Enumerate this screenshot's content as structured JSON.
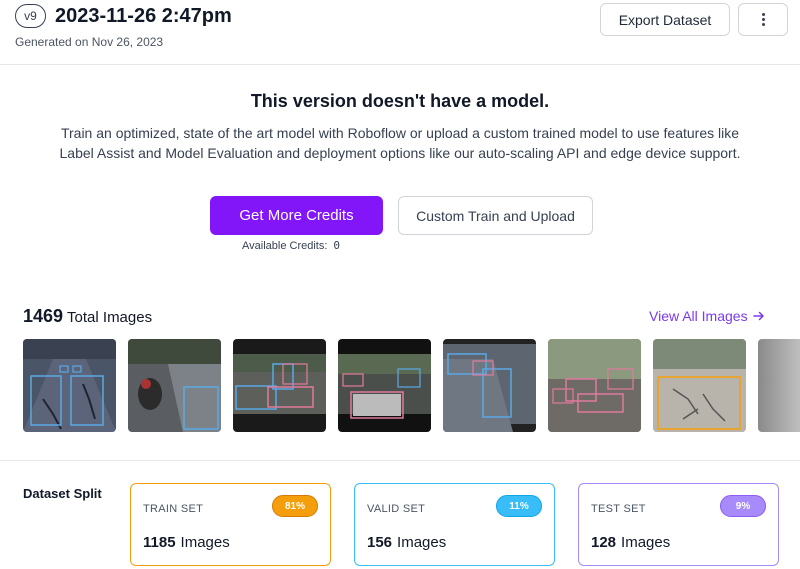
{
  "header": {
    "version": "v9",
    "title": "2023-11-26 2:47pm",
    "subtitle": "Generated on Nov 26, 2023",
    "export_label": "Export Dataset",
    "more_icon": "kebab-menu-icon"
  },
  "no_model": {
    "heading": "This version doesn't have a model.",
    "description": "Train an optimized, state of the art model with Roboflow or upload a custom trained model to use features like Label Assist and Model Evaluation and deployment options like our auto-scaling API and edge device support.",
    "primary_button": "Get More Credits",
    "secondary_button": "Custom Train and Upload",
    "credits_label": "Available Credits:",
    "credits_value": "0"
  },
  "images": {
    "count": "1469",
    "label": "Total Images",
    "view_all": "View All Images",
    "view_all_icon": "arrow-right-icon"
  },
  "split": {
    "label": "Dataset Split",
    "cards": [
      {
        "title": "TRAIN SET",
        "percent": "81%",
        "count": "1185",
        "unit": "Images",
        "accent": "#f59e0b"
      },
      {
        "title": "VALID SET",
        "percent": "11%",
        "count": "156",
        "unit": "Images",
        "accent": "#38bdf8"
      },
      {
        "title": "TEST SET",
        "percent": "9%",
        "count": "128",
        "unit": "Images",
        "accent": "#a78bfa"
      }
    ]
  },
  "colors": {
    "brand": "#8315f9",
    "link": "#7c3aed"
  }
}
